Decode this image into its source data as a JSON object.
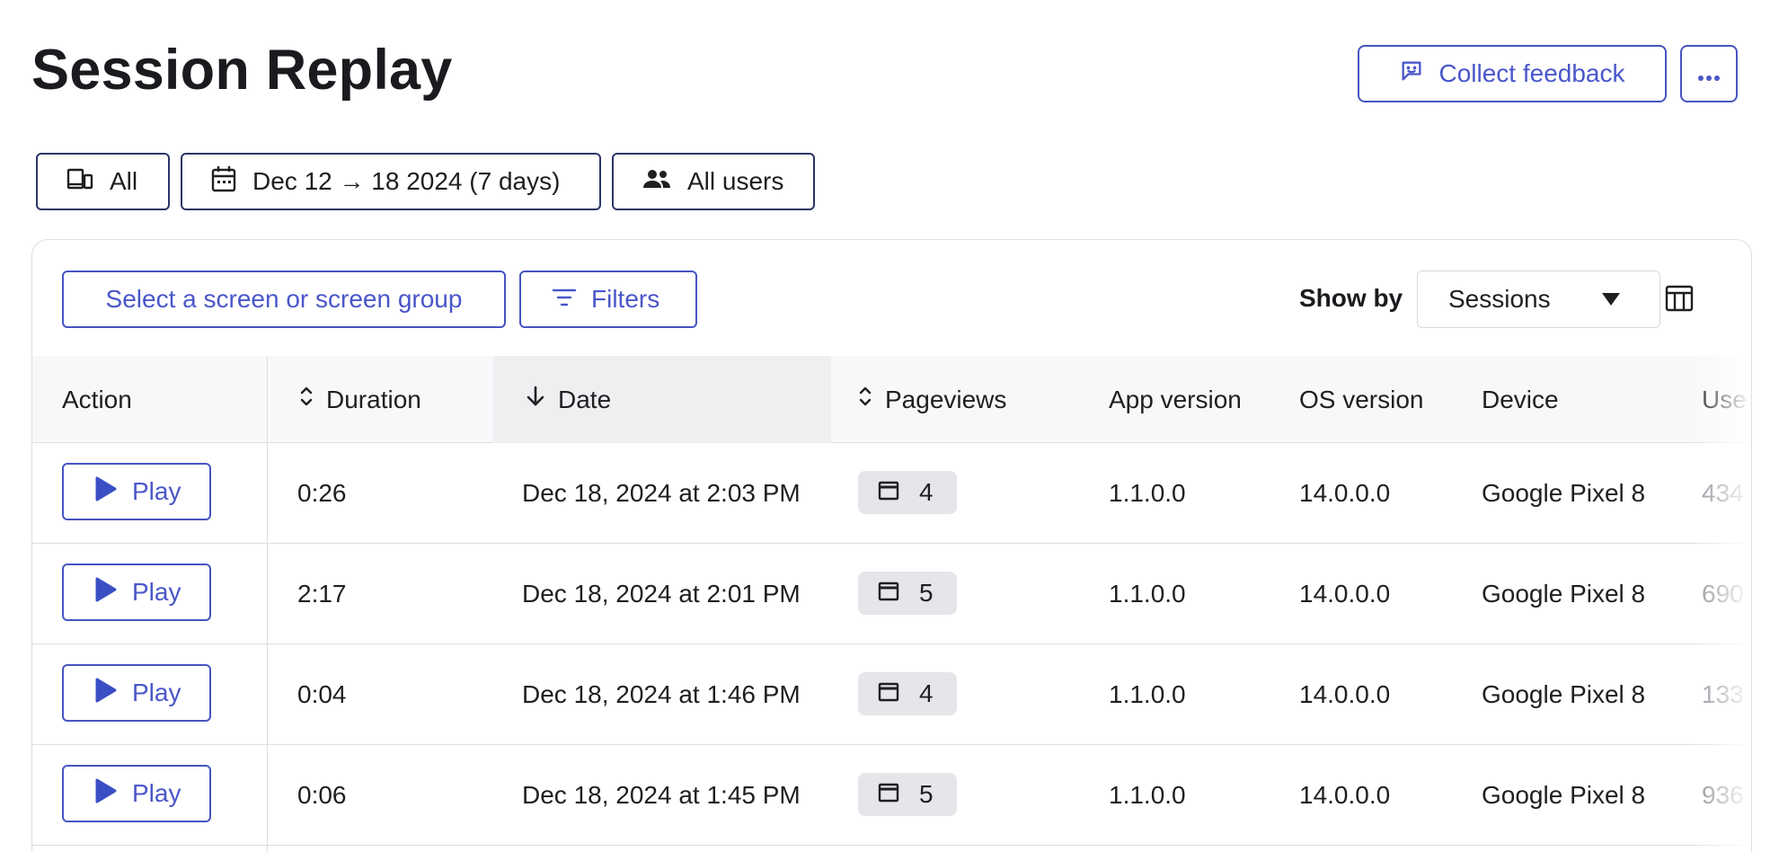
{
  "page": {
    "title": "Session Replay"
  },
  "header": {
    "feedback_label": "Collect feedback",
    "feedback_icon": "feedback-smiley-icon",
    "more_label": "···",
    "more_icon": "more-dots-icon"
  },
  "filters": {
    "device": {
      "label": "All",
      "icon": "devices-icon"
    },
    "date": {
      "label": "Dec 12 → 18 2024 (7 days)",
      "icon": "calendar-icon"
    },
    "users": {
      "label": "All users",
      "icon": "users-icon"
    }
  },
  "toolbar": {
    "screen_select_label": "Select a screen or screen group",
    "filters_label": "Filters",
    "filters_icon": "filter-lines-icon",
    "show_by_label": "Show by",
    "show_by_value": "Sessions",
    "columns_icon": "columns-icon"
  },
  "table": {
    "columns": {
      "action": "Action",
      "duration": "Duration",
      "date": "Date",
      "pageviews": "Pageviews",
      "app_version": "App version",
      "os_version": "OS version",
      "device": "Device",
      "user": "Use"
    },
    "sort": {
      "column": "Date",
      "direction": "descending"
    },
    "play_label": "Play",
    "rows": [
      {
        "duration": "0:26",
        "date": "Dec 18, 2024 at 2:03 PM",
        "pageviews": "4",
        "app_version": "1.1.0.0",
        "os_version": "14.0.0.0",
        "device": "Google Pixel 8",
        "user": "434"
      },
      {
        "duration": "2:17",
        "date": "Dec 18, 2024 at 2:01 PM",
        "pageviews": "5",
        "app_version": "1.1.0.0",
        "os_version": "14.0.0.0",
        "device": "Google Pixel 8",
        "user": "690"
      },
      {
        "duration": "0:04",
        "date": "Dec 18, 2024 at 1:46 PM",
        "pageviews": "4",
        "app_version": "1.1.0.0",
        "os_version": "14.0.0.0",
        "device": "Google Pixel 8",
        "user": "133"
      },
      {
        "duration": "0:06",
        "date": "Dec 18, 2024 at 1:45 PM",
        "pageviews": "5",
        "app_version": "1.1.0.0",
        "os_version": "14.0.0.0",
        "device": "Google Pixel 8",
        "user": "936"
      }
    ]
  },
  "colors": {
    "accent": "#4654c2",
    "accent_text": "#4a57c9",
    "chip_border": "#2a3566",
    "header_bg": "#f7f8f9",
    "sorted_header_bg": "#efeff2",
    "badge_bg": "#e5e5ea",
    "border": "#dedee3"
  }
}
